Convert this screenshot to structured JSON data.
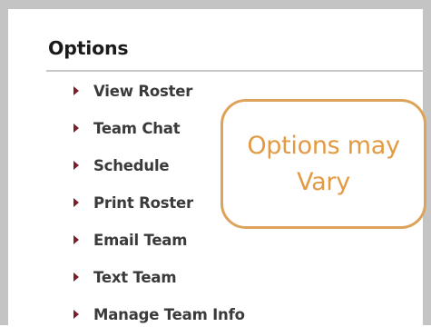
{
  "options_panel": {
    "heading": "Options",
    "items": [
      {
        "label": "View Roster"
      },
      {
        "label": "Team Chat"
      },
      {
        "label": "Schedule"
      },
      {
        "label": "Print Roster"
      },
      {
        "label": "Email Team"
      },
      {
        "label": "Text Team"
      },
      {
        "label": "Manage Team Info"
      }
    ],
    "arrow_icon": "triangle-right-icon",
    "arrow_color": "#7b1f2a"
  },
  "callout": {
    "line1": "Options may",
    "line2": "Vary",
    "border_color": "#dda35a",
    "text_color": "#e39a43"
  }
}
